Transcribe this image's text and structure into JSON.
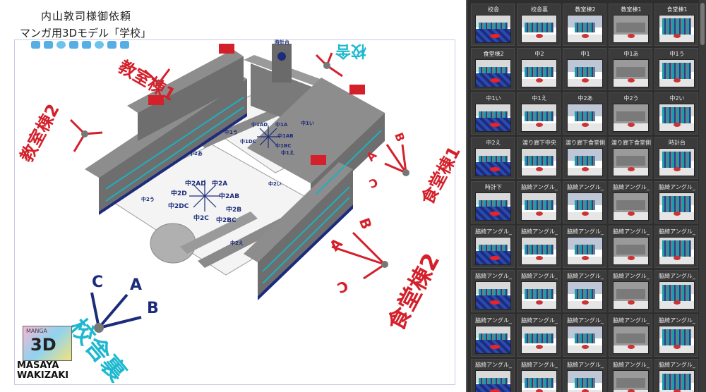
{
  "diagram": {
    "title_line1": "内山敦司様御依頼",
    "title_line2": "マンガ用3Dモデル「学校」",
    "labels": {
      "kyoshitsu1": "教室棟1",
      "kyoshitsu2": "教室棟2",
      "kosha": "校舎",
      "shokudo1": "食堂棟1",
      "shokudo2": "食堂棟2",
      "koshaura": "校舎裏",
      "a": "A",
      "b": "B",
      "c": "C",
      "naka1ad": "中1AD",
      "naka1a": "中1A",
      "naka1ab": "中1AB",
      "naka1dc": "中1DC",
      "naka1bc": "中1BC",
      "naka2ad": "中2AD",
      "naka2a": "中2A",
      "naka2ab": "中2AB",
      "naka2d": "中2D",
      "naka2b": "中2B",
      "naka2dc": "中2DC",
      "naka2c": "中2C",
      "naka2bc": "中2BC",
      "naka1i": "中1い",
      "naka1u": "中1う",
      "naka1e": "中1え",
      "naka2u": "中2う",
      "naka2i": "中2い",
      "naka2e": "中2え",
      "naka2a_h": "中2あ",
      "tokeidai": "時計台"
    },
    "logo_text": "3D",
    "logo_small": "MANGA",
    "author_line1": "MASAYA",
    "author_line2": "WAKIZAKI"
  },
  "panel": {
    "tiles": [
      "校舎",
      "校舎裏",
      "教室棟2",
      "教室棟1",
      "食堂棟1",
      "食堂棟2",
      "中2",
      "中1",
      "中1あ",
      "中1う",
      "中1い",
      "中1え",
      "中2あ",
      "中2う",
      "中2い",
      "中2え",
      "渡り廊下中央",
      "渡り廊下食堂側",
      "渡り廊下食堂側",
      "時計台",
      "時計下",
      "脇綺アングル_",
      "脇綺アングル_",
      "脇綺アングル_",
      "脇綺アングル_",
      "脇綺アングル_",
      "脇綺アングル_",
      "脇綺アングル_",
      "脇綺アングル_",
      "脇綺アングル_",
      "脇綺アングル_",
      "脇綺アングル_",
      "脇綺アングル_",
      "脇綺アングル_",
      "脇綺アングル_",
      "脇綺アングル_",
      "脇綺アングル_",
      "脇綺アングル_",
      "脇綺アングル_",
      "脇綺アングル_",
      "脇綺アングル_",
      "脇綺アングル_",
      "脇綺アングル_",
      "脇綺アングル_",
      "脇綺アングル_"
    ]
  },
  "colors": {
    "label_red": "#d4202a",
    "label_cyan": "#1db8cf",
    "label_navy": "#1d2c7a",
    "panel_bg": "#2e2e2e"
  }
}
